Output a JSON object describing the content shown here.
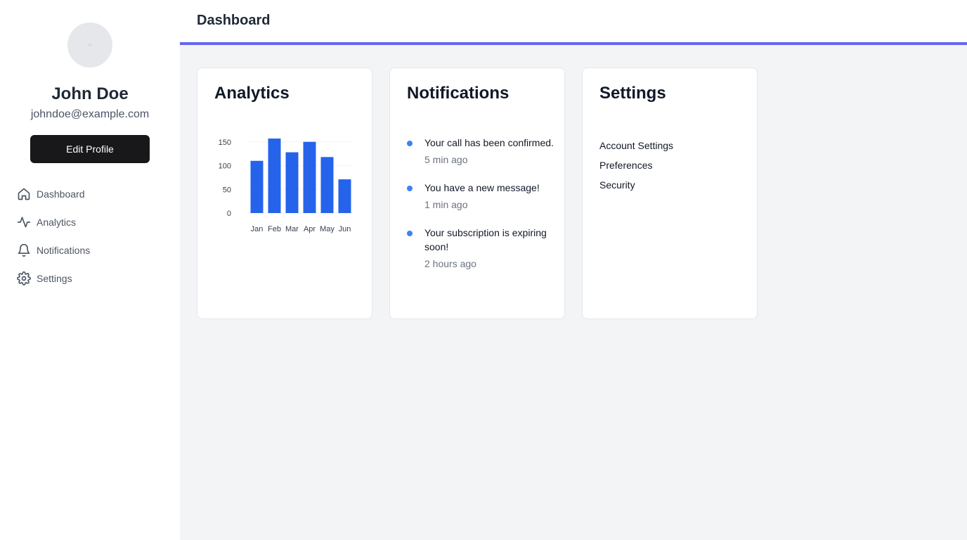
{
  "profile": {
    "name": "John Doe",
    "email": "johndoe@example.com",
    "edit_label": "Edit Profile"
  },
  "nav": {
    "items": [
      {
        "label": "Dashboard",
        "icon": "home-icon"
      },
      {
        "label": "Analytics",
        "icon": "activity-icon"
      },
      {
        "label": "Notifications",
        "icon": "bell-icon"
      },
      {
        "label": "Settings",
        "icon": "gear-icon"
      }
    ]
  },
  "header": {
    "title": "Dashboard"
  },
  "analytics": {
    "title": "Analytics"
  },
  "notifications": {
    "title": "Notifications",
    "items": [
      {
        "message": "Your call has been confirmed.",
        "time": "5 min ago"
      },
      {
        "message": "You have a new message!",
        "time": "1 min ago"
      },
      {
        "message": "Your subscription is expiring soon!",
        "time": "2 hours ago"
      }
    ]
  },
  "settings": {
    "title": "Settings",
    "items": [
      "Account Settings",
      "Preferences",
      "Security"
    ]
  },
  "colors": {
    "accent": "#6366f1",
    "bar": "#2563eb",
    "notification_dot": "#3b82f6",
    "button": "#18181b"
  },
  "chart_data": {
    "type": "bar",
    "categories": [
      "Jan",
      "Feb",
      "Mar",
      "Apr",
      "May",
      "Jun"
    ],
    "values": [
      110,
      157,
      128,
      150,
      118,
      71
    ],
    "yticks": [
      0,
      50,
      100,
      150
    ],
    "ylim": [
      0,
      160
    ],
    "grid": true
  }
}
